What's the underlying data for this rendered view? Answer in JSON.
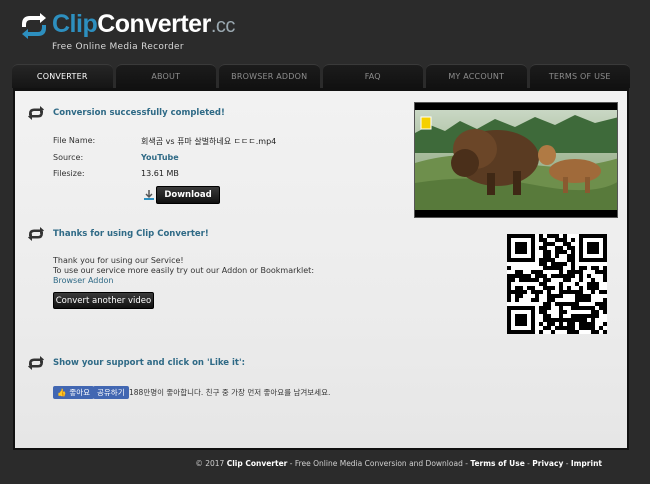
{
  "header": {
    "logo_clip": "Clip",
    "logo_converter": "Converter",
    "logo_cc": ".cc",
    "subtitle": "Free Online Media Recorder"
  },
  "tabs": [
    {
      "label": "CONVERTER",
      "active": true
    },
    {
      "label": "ABOUT"
    },
    {
      "label": "BROWSER ADDON"
    },
    {
      "label": "FAQ"
    },
    {
      "label": "MY ACCOUNT"
    },
    {
      "label": "TERMS OF USE"
    }
  ],
  "result": {
    "title": "Conversion successfully completed!",
    "file_name_label": "File Name:",
    "file_name": "회색곰 vs 퓨마 살벌하네요 ㄷㄷㄷ.mp4",
    "source_label": "Source:",
    "source": "YouTube",
    "filesize_label": "Filesize:",
    "filesize": "13.61 MB",
    "download_label": "Download"
  },
  "thanks": {
    "title": "Thanks for using Clip Converter!",
    "line1": "Thank you for using our Service!",
    "line2": "To use our service more easily try out our Addon or Bookmarklet:",
    "addon_link": "Browser Addon",
    "convert_another_label": "Convert another video"
  },
  "support": {
    "title": "Show your support and click on 'Like it':",
    "like_label": "좋아요",
    "share_label": "공유하기",
    "like_text": "188만명이 좋아합니다. 친구 중 가장 먼저 좋아요를 남겨보세요."
  },
  "footer": {
    "prefix": "© 2017",
    "brand": "Clip Converter",
    "tagline": " - Free Online Media Conversion and Download - ",
    "terms": "Terms of Use",
    "privacy": "Privacy",
    "imprint": "Imprint",
    "sep": " - "
  },
  "colors": {
    "accent": "#2f6a86",
    "facebook": "#4267b2"
  }
}
